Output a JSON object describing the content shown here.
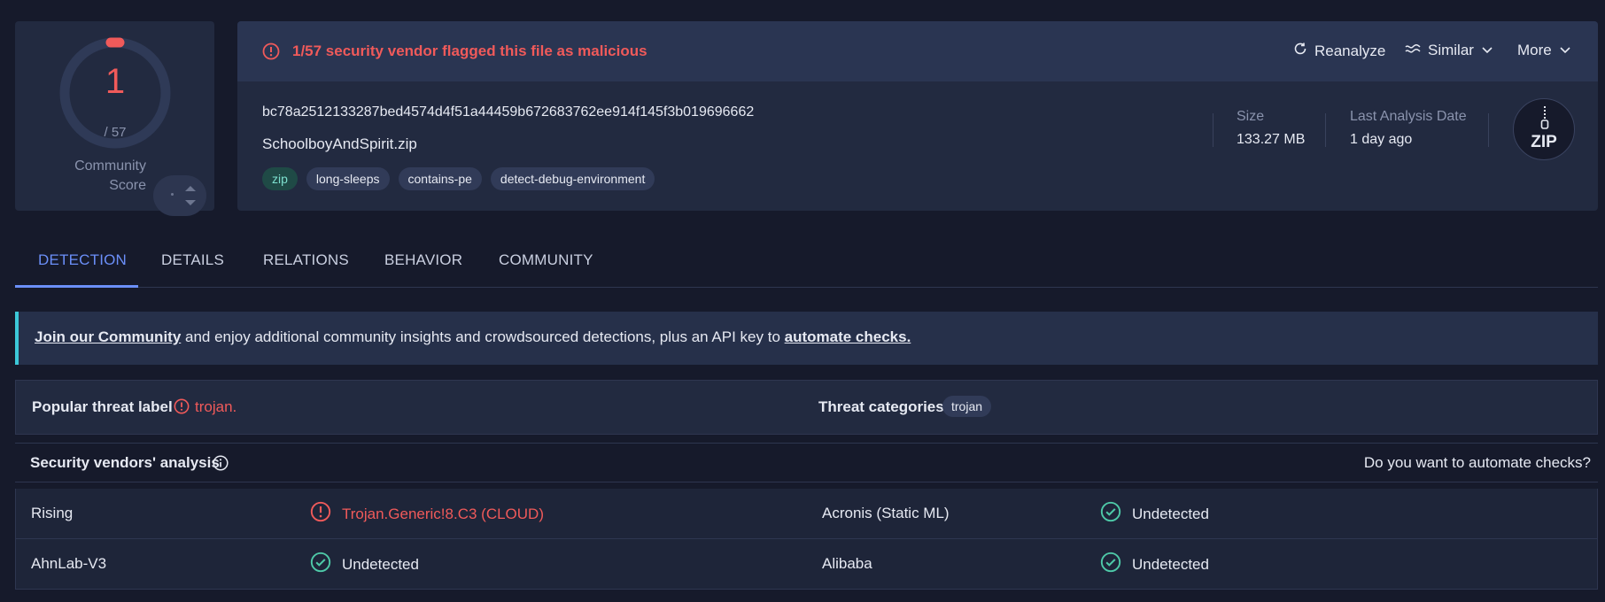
{
  "score": {
    "detections": "1",
    "total": "/ 57",
    "detection_fraction": 0.0175,
    "community_label_1": "Community",
    "community_label_2": "Score",
    "community_value": "-"
  },
  "alert": {
    "text": "1/57 security vendor flagged this file as malicious",
    "icon": "alert-circle-icon"
  },
  "actions": {
    "reanalyze": "Reanalyze",
    "similar": "Similar",
    "more": "More"
  },
  "file": {
    "hash": "bc78a2512133287bed4574d4f51a44459b672683762ee914f145f3b019696662",
    "name": "SchoolboyAndSpirit.zip",
    "tags": [
      "zip",
      "long-sleeps",
      "contains-pe",
      "detect-debug-environment"
    ],
    "size_label": "Size",
    "size_value": "133.27 MB",
    "date_label": "Last Analysis Date",
    "date_value": "1 day ago",
    "type_badge": "ZIP"
  },
  "tabs": [
    "DETECTION",
    "DETAILS",
    "RELATIONS",
    "BEHAVIOR",
    "COMMUNITY"
  ],
  "banner": {
    "link1": "Join our Community",
    "middle": " and enjoy additional community insights and crowdsourced detections, plus an API key to ",
    "link2": "automate checks."
  },
  "threat": {
    "popular_label": "Popular threat label",
    "popular_value": "trojan.",
    "categories_label": "Threat categories",
    "category": "trojan"
  },
  "vendors": {
    "title": "Security vendors' analysis",
    "automate": "Do you want to automate checks?",
    "rows": [
      {
        "left_name": "Rising",
        "left_result": "Trojan.Generic!8.C3 (CLOUD)",
        "left_status": "malicious",
        "right_name": "Acronis (Static ML)",
        "right_result": "Undetected",
        "right_status": "undetected"
      },
      {
        "left_name": "AhnLab-V3",
        "left_result": "Undetected",
        "left_status": "undetected",
        "right_name": "Alibaba",
        "right_result": "Undetected",
        "right_status": "undetected"
      }
    ]
  },
  "colors": {
    "malicious": "#f05a5a",
    "undetected": "#4ec9a8",
    "accent": "#6b8ff8",
    "banner_border": "#3cc8d8"
  }
}
